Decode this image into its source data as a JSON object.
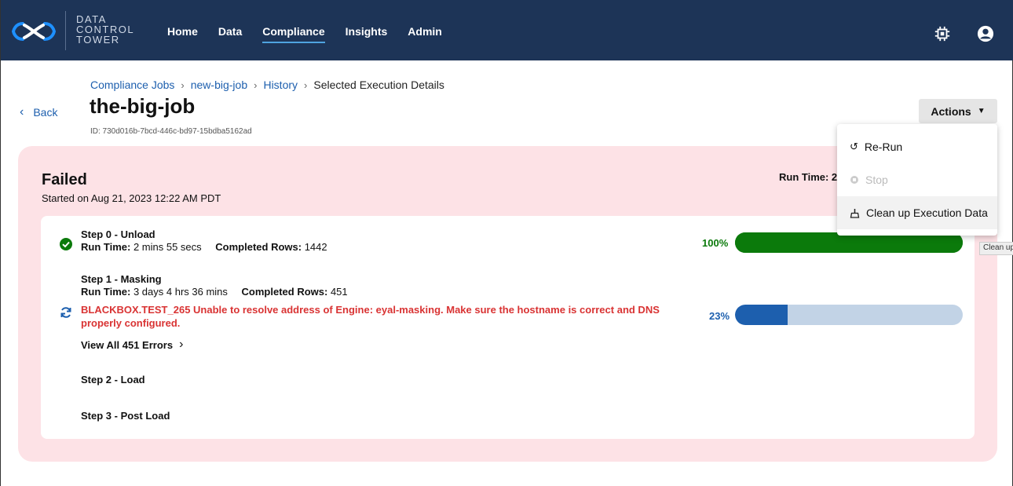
{
  "app": {
    "logo_lines": [
      "DATA",
      "CONTROL",
      "TOWER"
    ],
    "nav": [
      {
        "label": "Home",
        "active": false
      },
      {
        "label": "Data",
        "active": false
      },
      {
        "label": "Compliance",
        "active": true
      },
      {
        "label": "Insights",
        "active": false
      },
      {
        "label": "Admin",
        "active": false
      }
    ],
    "icons": [
      "chip-icon",
      "account-icon"
    ]
  },
  "header": {
    "breadcrumb": [
      "Compliance Jobs",
      "new-big-job",
      "History"
    ],
    "breadcrumb_current": "Selected Execution Details",
    "back_label": "Back",
    "title": "the-big-job",
    "job_id": "ID: 730d016b-7bcd-446c-bd97-15bdba5162ad",
    "actions_label": "Actions"
  },
  "execution": {
    "status": "Failed",
    "started": "Started on Aug 21, 2023 12:22 AM PDT",
    "runtime_label": "Run Time: 2",
    "steps": [
      {
        "name": "Step 0 - Unload",
        "runtime_label": "Run Time:",
        "runtime": "2 mins 55 secs",
        "rows_label": "Completed Rows:",
        "rows": "1442",
        "progress_text": "100%",
        "progress": 1.0,
        "state": "success"
      },
      {
        "name": "Step 1 - Masking",
        "runtime_label": "Run Time:",
        "runtime": "3 days 4 hrs 36 mins",
        "rows_label": "Completed Rows:",
        "rows": "451",
        "error": "BLACKBOX.TEST_265 Unable to resolve address of Engine: eyal-masking. Make sure the hostname is correct and DNS properly configured.",
        "view_errors": "View All 451 Errors",
        "progress_text": "23%",
        "progress": 0.23,
        "state": "running"
      },
      {
        "name": "Step 2 - Load"
      },
      {
        "name": "Step 3 - Post Load"
      }
    ]
  },
  "actions_menu": {
    "items": [
      {
        "label": "Re-Run",
        "icon": "rerun-icon",
        "disabled": false
      },
      {
        "label": "Stop",
        "icon": "stop-icon",
        "disabled": true
      },
      {
        "label": "Clean up Execution Data",
        "icon": "broom-icon",
        "disabled": false
      }
    ],
    "tooltip": "Clean up"
  },
  "colors": {
    "topbar": "#1d3457",
    "panel": "#fde2e6",
    "success": "#0b7a0b",
    "progress_blue": "#1d5fae",
    "progress_track": "#c2d3e6",
    "error": "#d93333"
  }
}
